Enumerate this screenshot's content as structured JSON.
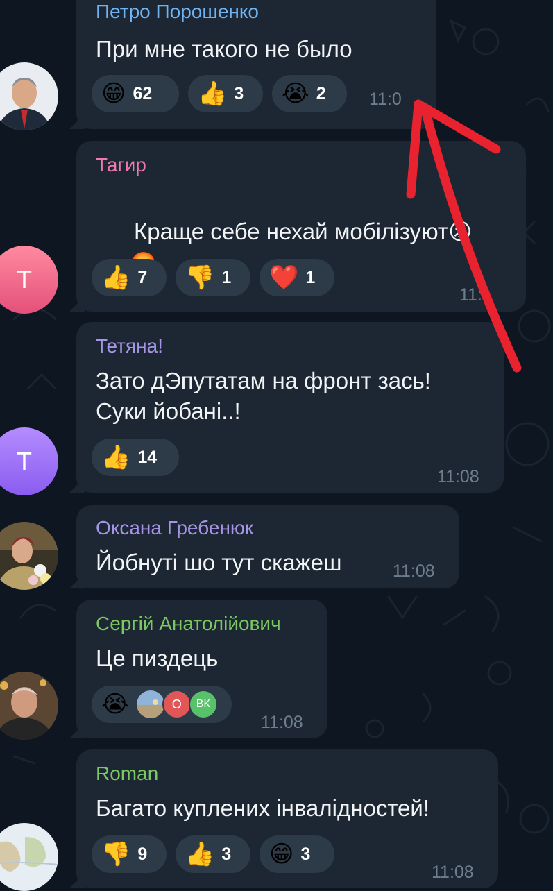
{
  "colors": {
    "background": "#0e1621",
    "bubble": "#1c2733",
    "reaction_pill": "#2d3a48",
    "annotation_arrow": "#e8232f"
  },
  "messages": [
    {
      "author": "Петро Порошенко",
      "author_color": "#6fb3f2",
      "text": "При мне такого не было",
      "time": "11:0",
      "reactions": [
        {
          "emoji": "😁",
          "count": "62"
        },
        {
          "emoji": "👍",
          "count": "3"
        },
        {
          "emoji": "😭",
          "count": "2"
        }
      ]
    },
    {
      "author": "Тагир",
      "author_color": "#ee7aae",
      "text": "Краще себе нехай мобілізуют",
      "text_emoji": "😡",
      "text_line2_emoji": "🤬",
      "time": "11:",
      "avatar_letter": "Т",
      "reactions": [
        {
          "emoji": "👍",
          "count": "7"
        },
        {
          "emoji": "👎",
          "count": "1"
        },
        {
          "emoji": "❤️",
          "count": "1"
        }
      ]
    },
    {
      "author": "Тетяна!",
      "author_color": "#a695e7",
      "text_line1": "Зато дЭпутатам на фронт засьǃ",
      "text_line2": "Суки йобані..!",
      "time": "11:08",
      "avatar_letter": "Т",
      "reactions": [
        {
          "emoji": "👍",
          "count": "14"
        }
      ]
    },
    {
      "author": "Оксана Гребенюк",
      "author_color": "#a695e7",
      "text": "Йобнуті шо тут скажеш",
      "time": "11:08"
    },
    {
      "author": "Сергій Анатолійович",
      "author_color": "#7bc862",
      "text": "Це пиздець",
      "time": "11:08",
      "reactions": [
        {
          "emoji": "😭",
          "count": ""
        }
      ],
      "reactor_avatars": [
        "О",
        "ВК"
      ]
    },
    {
      "author": "Roman",
      "author_color": "#7bc862",
      "text": "Багато куплених інвалідностей!",
      "time": "11:08",
      "reactions": [
        {
          "emoji": "👎",
          "count": "9"
        },
        {
          "emoji": "👍",
          "count": "3"
        },
        {
          "emoji": "😁",
          "count": "3"
        }
      ]
    }
  ]
}
